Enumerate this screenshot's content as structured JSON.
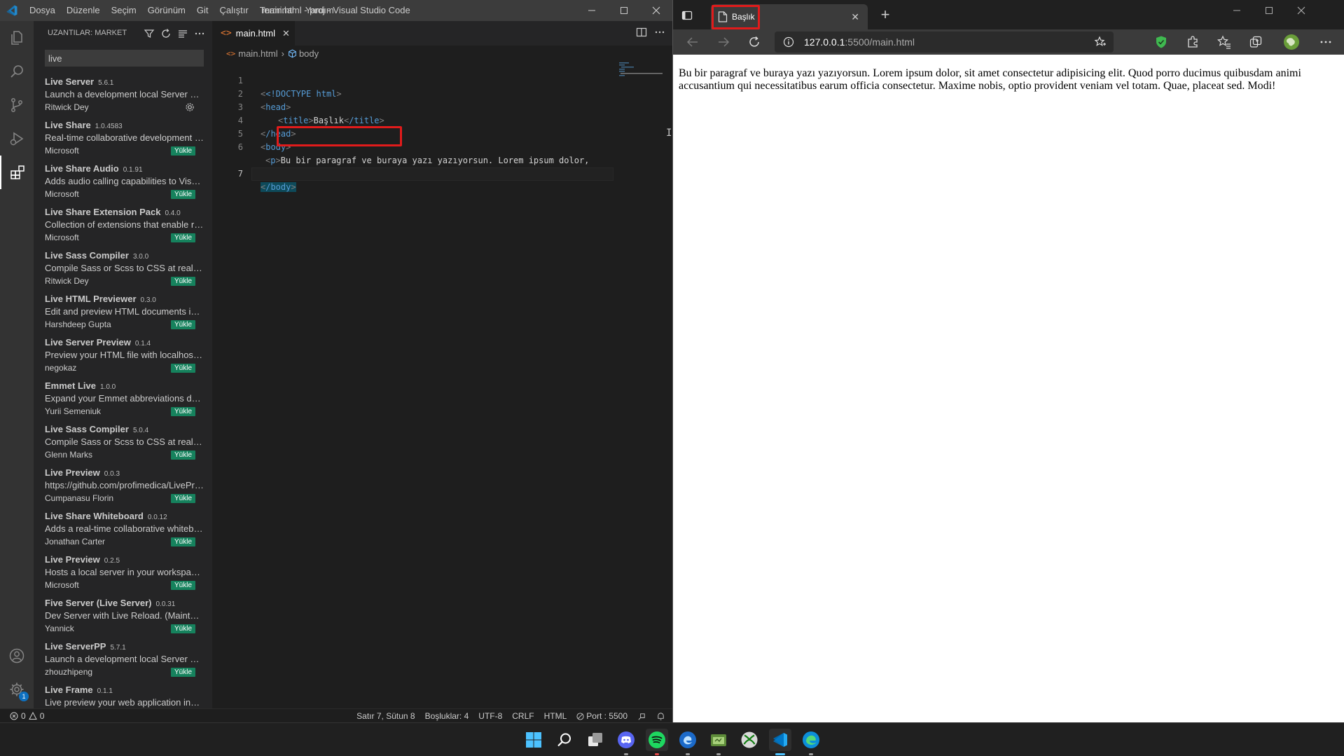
{
  "vscode": {
    "menu": [
      "Dosya",
      "Düzenle",
      "Seçim",
      "Görünüm",
      "Git",
      "Çalıştır",
      "Terminal",
      "Yardım"
    ],
    "window_title": "main.html - proj - Visual Studio Code",
    "sidebar": {
      "title": "UZANTILAR: MARKET",
      "search_value": "live",
      "extensions": [
        {
          "name": "Live Server",
          "version": "5.6.1",
          "description": "Launch a development local Server with live reload feature for static & dynamic pages",
          "publisher": "Ritwick Dey",
          "installed": true
        },
        {
          "name": "Live Share",
          "version": "1.0.4583",
          "description": "Real-time collaborative development from the comfort of your favorite tools.",
          "publisher": "Microsoft",
          "action": "Yükle"
        },
        {
          "name": "Live Share Audio",
          "version": "0.1.91",
          "description": "Adds audio calling capabilities to Visual Studio Live Share",
          "publisher": "Microsoft",
          "action": "Yükle"
        },
        {
          "name": "Live Share Extension Pack",
          "version": "0.4.0",
          "description": "Collection of extensions that enable real-time collaborative development",
          "publisher": "Microsoft",
          "action": "Yükle"
        },
        {
          "name": "Live Sass Compiler",
          "version": "3.0.0",
          "description": "Compile Sass or Scss to CSS at realtime with live browser reload.",
          "publisher": "Ritwick Dey",
          "action": "Yükle"
        },
        {
          "name": "Live HTML Previewer",
          "version": "0.3.0",
          "description": "Edit and preview HTML documents in VS Code",
          "publisher": "Harshdeep Gupta",
          "action": "Yükle"
        },
        {
          "name": "Live Server Preview",
          "version": "0.1.4",
          "description": "Preview your HTML file with localhost server live-reloading enabled",
          "publisher": "negokaz",
          "action": "Yükle"
        },
        {
          "name": "Emmet Live",
          "version": "1.0.0",
          "description": "Expand your Emmet abbreviations dynamically",
          "publisher": "Yurii Semeniuk",
          "action": "Yükle"
        },
        {
          "name": "Live Sass Compiler",
          "version": "5.0.4",
          "description": "Compile Sass or Scss to CSS at realtime.",
          "publisher": "Glenn Marks",
          "action": "Yükle"
        },
        {
          "name": "Live Preview",
          "version": "0.0.3",
          "description": "https://github.com/profimedica/LivePreview",
          "publisher": "Cumpanasu Florin",
          "action": "Yükle"
        },
        {
          "name": "Live Share Whiteboard",
          "version": "0.0.12",
          "description": "Adds a real-time collaborative whiteboard to Live Share",
          "publisher": "Jonathan Carter",
          "action": "Yükle"
        },
        {
          "name": "Live Preview",
          "version": "0.2.5",
          "description": "Hosts a local server in your workspace for you to preview your webpages on.",
          "publisher": "Microsoft",
          "action": "Yükle"
        },
        {
          "name": "Five Server (Live Server)",
          "version": "0.0.31",
          "description": "Dev Server with Live Reload. (Maintained Fork of Live Server)",
          "publisher": "Yannick",
          "action": "Yükle"
        },
        {
          "name": "Live ServerPP",
          "version": "5.7.1",
          "description": "Launch a development local Server with live reload feature",
          "publisher": "zhouzhipeng",
          "action": "Yükle"
        },
        {
          "name": "Live Frame",
          "version": "0.1.1",
          "description": "Live preview your web application inside VS Code",
          "publisher": "",
          "action": ""
        }
      ]
    },
    "editor": {
      "tab_label": "main.html",
      "breadcrumb_file": "main.html",
      "breadcrumb_symbol": "body",
      "line_numbers": [
        "1",
        "2",
        "3",
        "4",
        "5",
        "6",
        "7"
      ],
      "current_line": "7",
      "code": {
        "l1_doctype": "<!DOCTYPE",
        "l1_html": "html",
        "l2": "head",
        "l3_open": "title",
        "l3_text": "Başlık",
        "l3_close": "/title",
        "l4": "/head",
        "l5": "body",
        "l6_tag": "p",
        "l6_text": "Bu bir paragraf ve buraya yazı yazıyorsun. Lorem ipsum dolor,",
        "l7": "/body"
      }
    },
    "statusbar": {
      "errors": "0",
      "warnings": "0",
      "position": "Satır 7, Sütun 8",
      "spaces": "Boşluklar: 4",
      "encoding": "UTF-8",
      "eol": "CRLF",
      "language": "HTML",
      "port": "Port : 5500"
    },
    "notification_count": "1"
  },
  "browser": {
    "tab_title": "Başlık",
    "url_host": "127.0.0.1",
    "url_rest": ":5500/main.html",
    "content": "Bu bir paragraf ve buraya yazı yazıyorsun. Lorem ipsum dolor, sit amet consectetur adipisicing elit. Quod porro ducimus quibusdam animi accusantium qui necessitatibus earum officia consectetur. Maxime nobis, optio provident veniam vel totam. Quae, placeat sed. Modi!"
  },
  "colors": {
    "vscode_titlebar": "#3c3c3c",
    "vscode_activitybar": "#333333",
    "vscode_sidebar": "#252526",
    "vscode_editor": "#1e1e1e",
    "install_button": "#16825d",
    "html_tag": "#569cd6",
    "highlight_box": "#e11b1b"
  },
  "icons": {
    "activity": [
      "files-icon",
      "search-icon",
      "source-control-icon",
      "run-debug-icon",
      "extensions-icon",
      "account-icon",
      "settings-gear-icon"
    ],
    "taskbar": [
      "windows-start-icon",
      "search-icon",
      "task-view-icon",
      "discord-icon",
      "spotify-icon",
      "edge-dev-icon",
      "folder-app-icon",
      "xbox-icon",
      "vscode-icon",
      "edge-icon"
    ]
  }
}
